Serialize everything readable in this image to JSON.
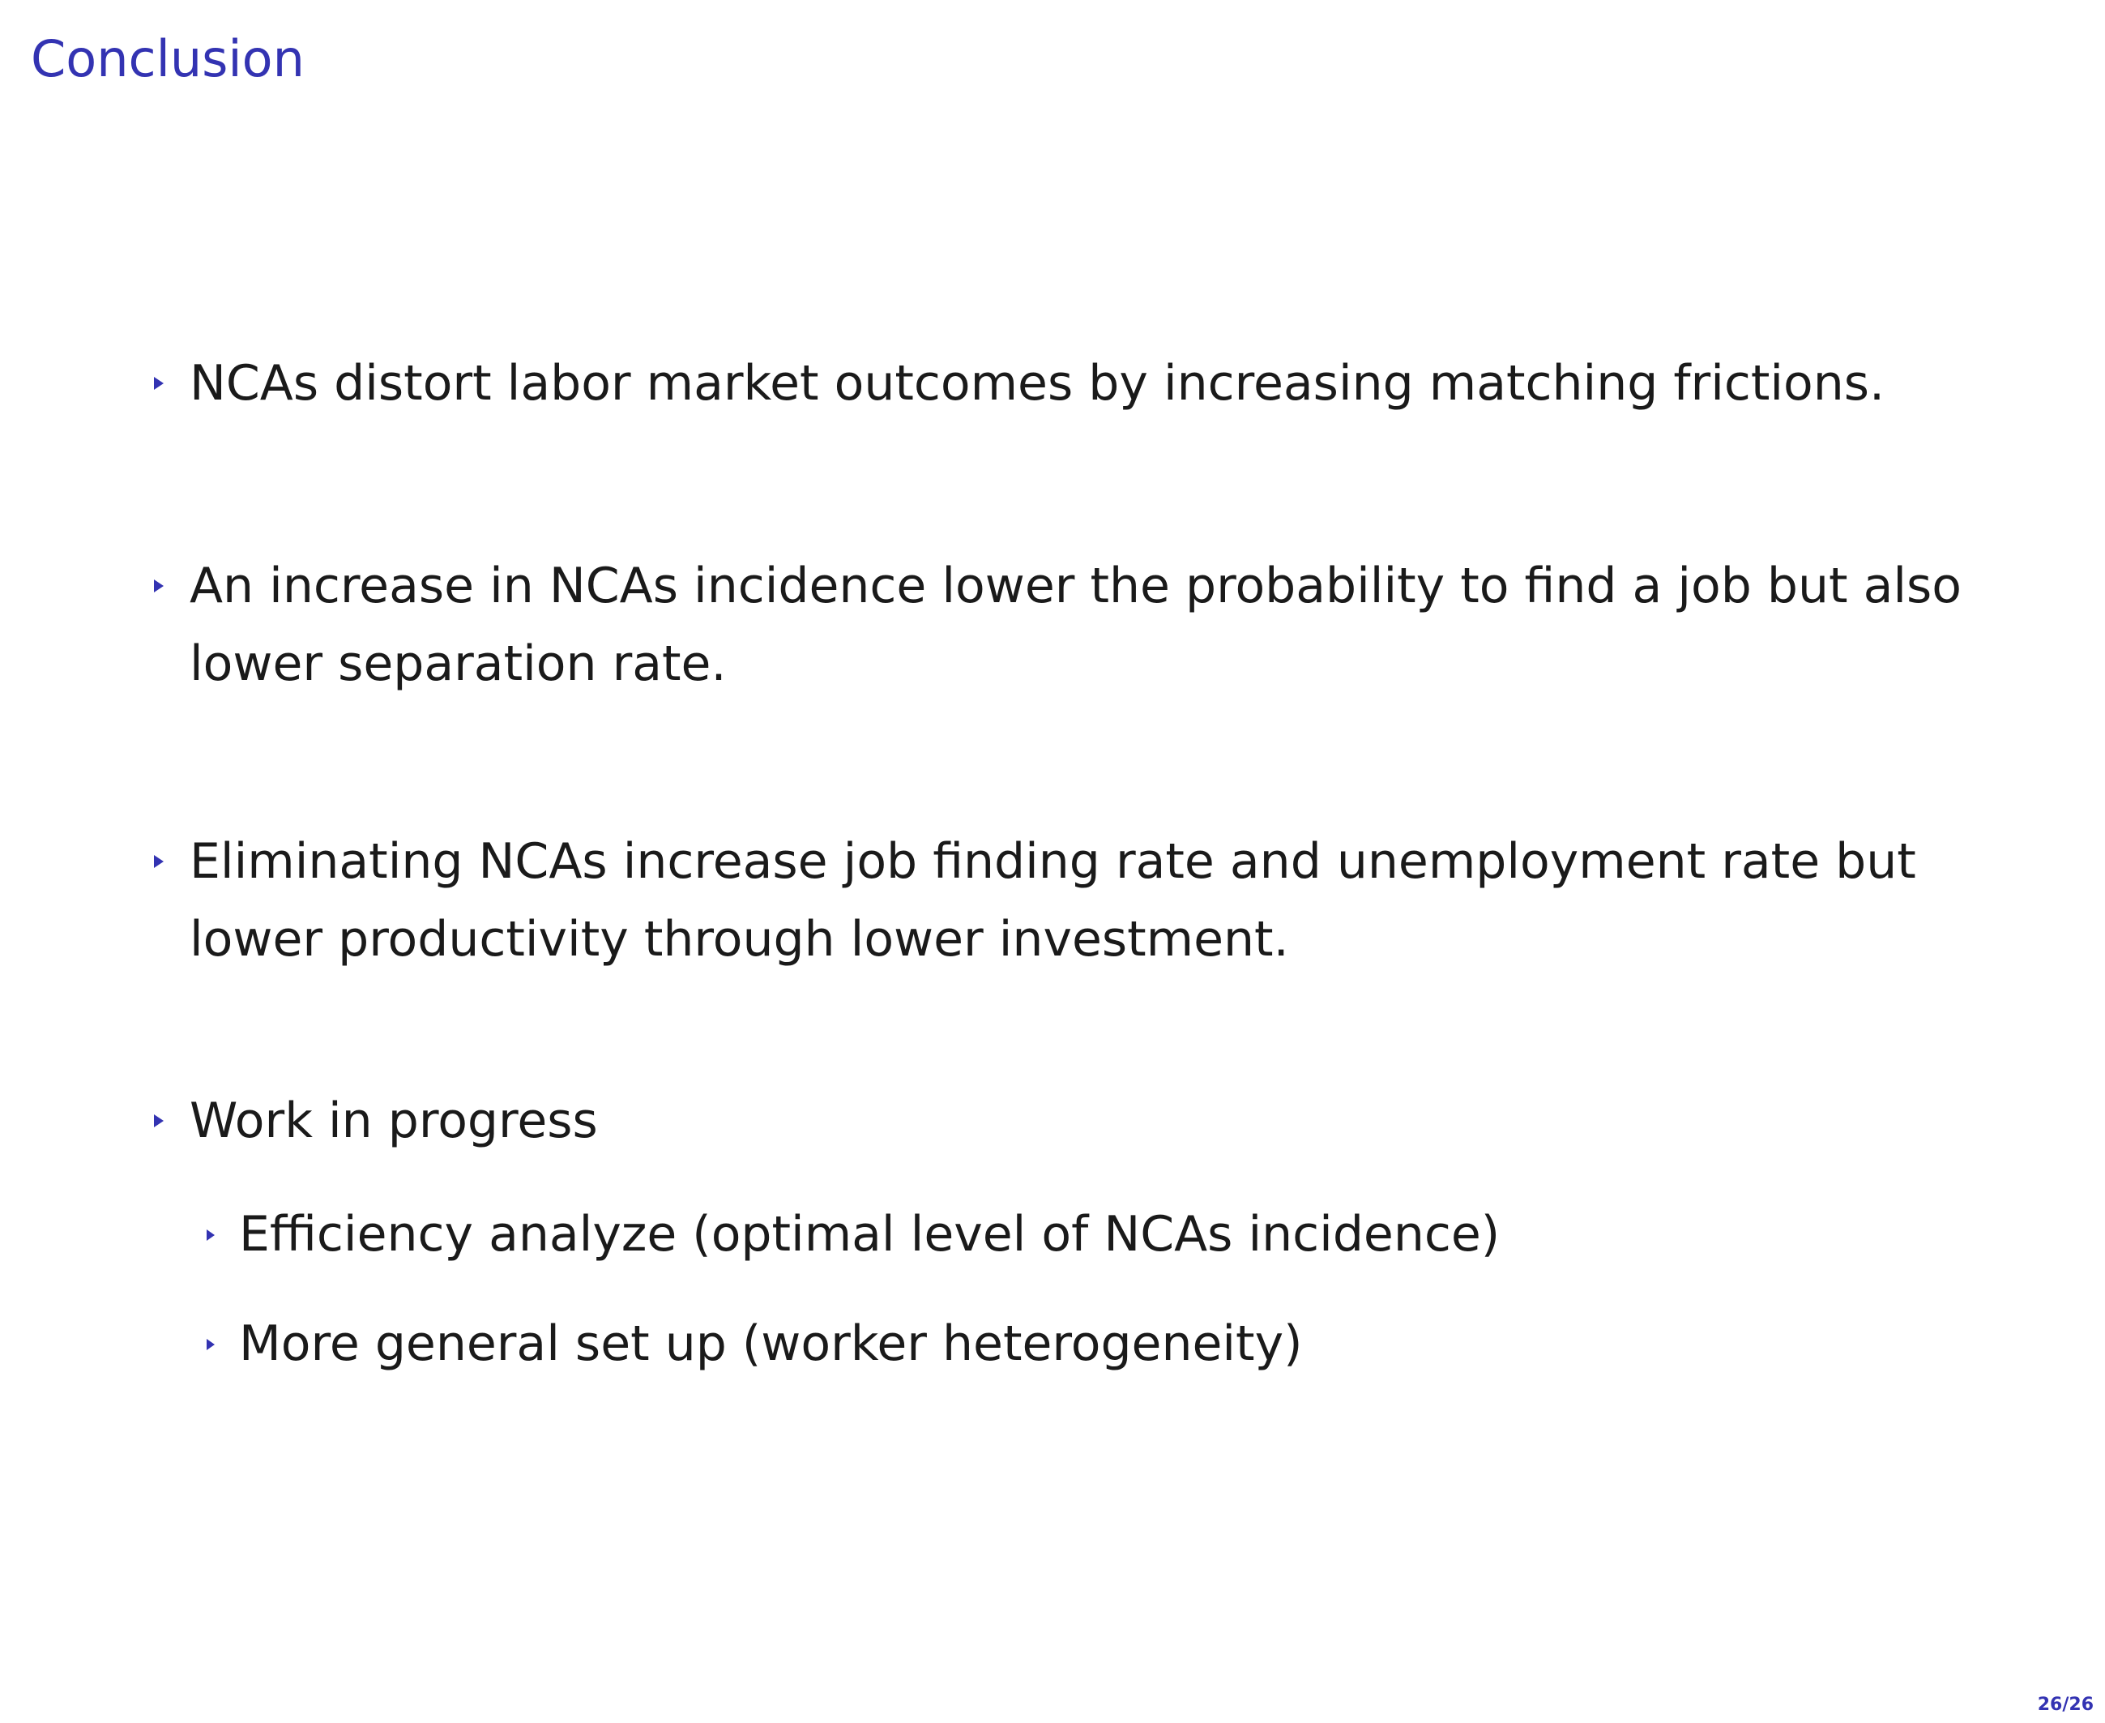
{
  "slide": {
    "title": "Conclusion",
    "page_number": "26/26"
  },
  "bullets": [
    {
      "text": "NCAs distort labor market outcomes by increasing matching frictions."
    },
    {
      "text": "An increase in NCAs incidence lower the probability to find a job but also lower separation rate."
    },
    {
      "text": "Eliminating NCAs increase job finding rate and unemployment rate but lower productivity through lower investment."
    },
    {
      "text": "Work in progress",
      "subitems": [
        {
          "text": "Efficiency analyze (optimal level of NCAs incidence)"
        },
        {
          "text": "More general set up (worker heterogeneity)"
        }
      ]
    }
  ],
  "colors": {
    "accent": "#3333b2",
    "text": "#1a1a1a",
    "background": "#ffffff"
  },
  "icons": {
    "bullet": "triangle-right-icon"
  }
}
